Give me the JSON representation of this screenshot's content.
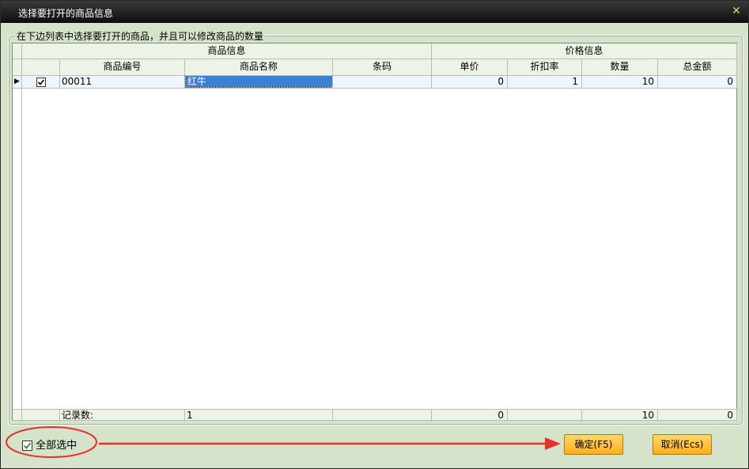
{
  "window": {
    "title": "选择要打开的商品信息",
    "close_icon": "close-icon"
  },
  "group": {
    "title": "在下边列表中选择要打开的商品，并且可以修改商品的数量"
  },
  "grid": {
    "group_headers": {
      "product_info": "商品信息",
      "price_info": "价格信息"
    },
    "columns": {
      "code": "商品编号",
      "name": "商品名称",
      "barcode": "条码",
      "unit_price": "单价",
      "discount": "折扣率",
      "quantity": "数量",
      "total": "总金额"
    },
    "rows": [
      {
        "checked": true,
        "code": "00011",
        "name": "红牛",
        "barcode": "",
        "unit_price": "0",
        "discount": "1",
        "quantity": "10",
        "total": "0"
      }
    ],
    "footer": {
      "label": "记录数:",
      "count": "1",
      "unit_price": "0",
      "quantity": "10",
      "total": "0"
    }
  },
  "bottom": {
    "select_all_label": "全部选中",
    "select_all_checked": true,
    "ok_button": "确定(F5)",
    "cancel_button": "取消(Ecs)"
  },
  "annotation_color": "#e8302a"
}
